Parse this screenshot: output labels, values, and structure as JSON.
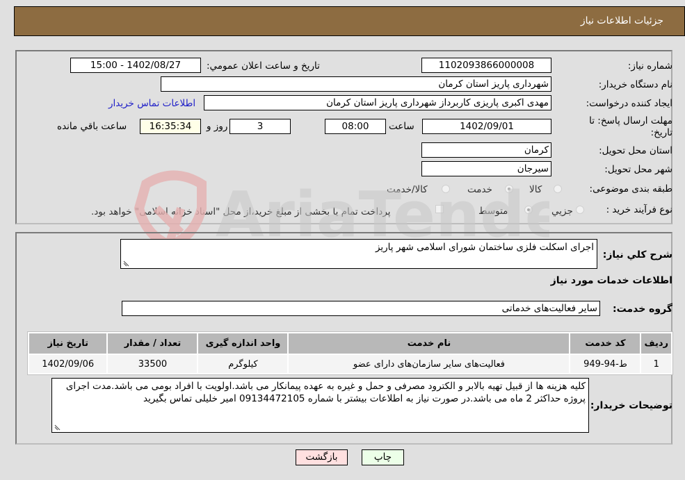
{
  "header": {
    "title": "جزئیات اطلاعات نیاز"
  },
  "form": {
    "need_number": {
      "label": "شماره نیاز:",
      "value": "1102093866000008"
    },
    "announce_datetime": {
      "label": "تاریخ و ساعت اعلان عمومي:",
      "value": "1402/08/27 - 15:00"
    },
    "buyer_org": {
      "label": "نام دستگاه خریدار:",
      "value": "شهرداری پاریز استان کرمان"
    },
    "requester": {
      "label": "ایجاد کننده درخواست:",
      "value": "مهدی اکبری پاریزی کاربرداز شهرداری پاریز استان کرمان",
      "contact_link": "اطلاعات تماس خریدار"
    },
    "deadline": {
      "label": "مهلت ارسال پاسخ: تا تاریخ:",
      "date": "1402/09/01",
      "time_label": "ساعت",
      "time": "08:00",
      "days": "3",
      "days_label": "روز و",
      "remaining": "16:35:34",
      "remaining_label": "ساعت باقي مانده"
    },
    "province": {
      "label": "استان محل تحویل:",
      "value": "کرمان"
    },
    "city": {
      "label": "شهر محل تحویل:",
      "value": "سیرجان"
    },
    "category": {
      "label": "طبقه بندی موضوعی:",
      "options": [
        "کالا",
        "خدمت",
        "کالا/خدمت"
      ],
      "selected": "خدمت"
    },
    "process": {
      "label": "نوع فرآیند خرید :",
      "options": [
        "جزیي",
        "متوسط"
      ],
      "selected": "متوسط",
      "treasury_note": "پرداخت تمام یا بخشی از مبلغ خرید،از محل \"اسناد خزانه اسلامی\" خواهد بود."
    }
  },
  "details": {
    "general_desc": {
      "label": "شرح کلي نیاز:",
      "value": "اجرای اسکلت فلزی ساختمان شورای اسلامی شهر پاریز"
    },
    "services_title": "اطلاعات خدمات مورد نیاز",
    "service_group": {
      "label": "گروه خدمت:",
      "value": "سایر فعالیت‌های خدماتی"
    },
    "table": {
      "headers": [
        "ردیف",
        "کد خدمت",
        "نام خدمت",
        "واحد اندازه گیری",
        "تعداد / مقدار",
        "تاریخ نیاز"
      ],
      "rows": [
        [
          "1",
          "ط-94-949",
          "فعالیت‌های سایر سازمان‌های دارای عضو",
          "کیلوگرم",
          "33500",
          "1402/09/06"
        ]
      ]
    },
    "buyer_notes": {
      "label": "توضیحات خریدار:",
      "value": "کلیه هزینه ها از قبیل  تهیه بالابر و الکترود مصرفی و حمل و غیره به عهده پیمانکار می باشد.اولویت با افراد بومی می باشد.مدت اجرای پروژه حداکثر 2 ماه می باشد.در صورت نیاز به اطلاعات  بیشتر با شماره  09134472105 امیر خلیلی تماس بگیرید"
    }
  },
  "buttons": {
    "print": "چاپ",
    "back": "بازگشت"
  },
  "watermark": {
    "text": "AriaTender.neT"
  }
}
